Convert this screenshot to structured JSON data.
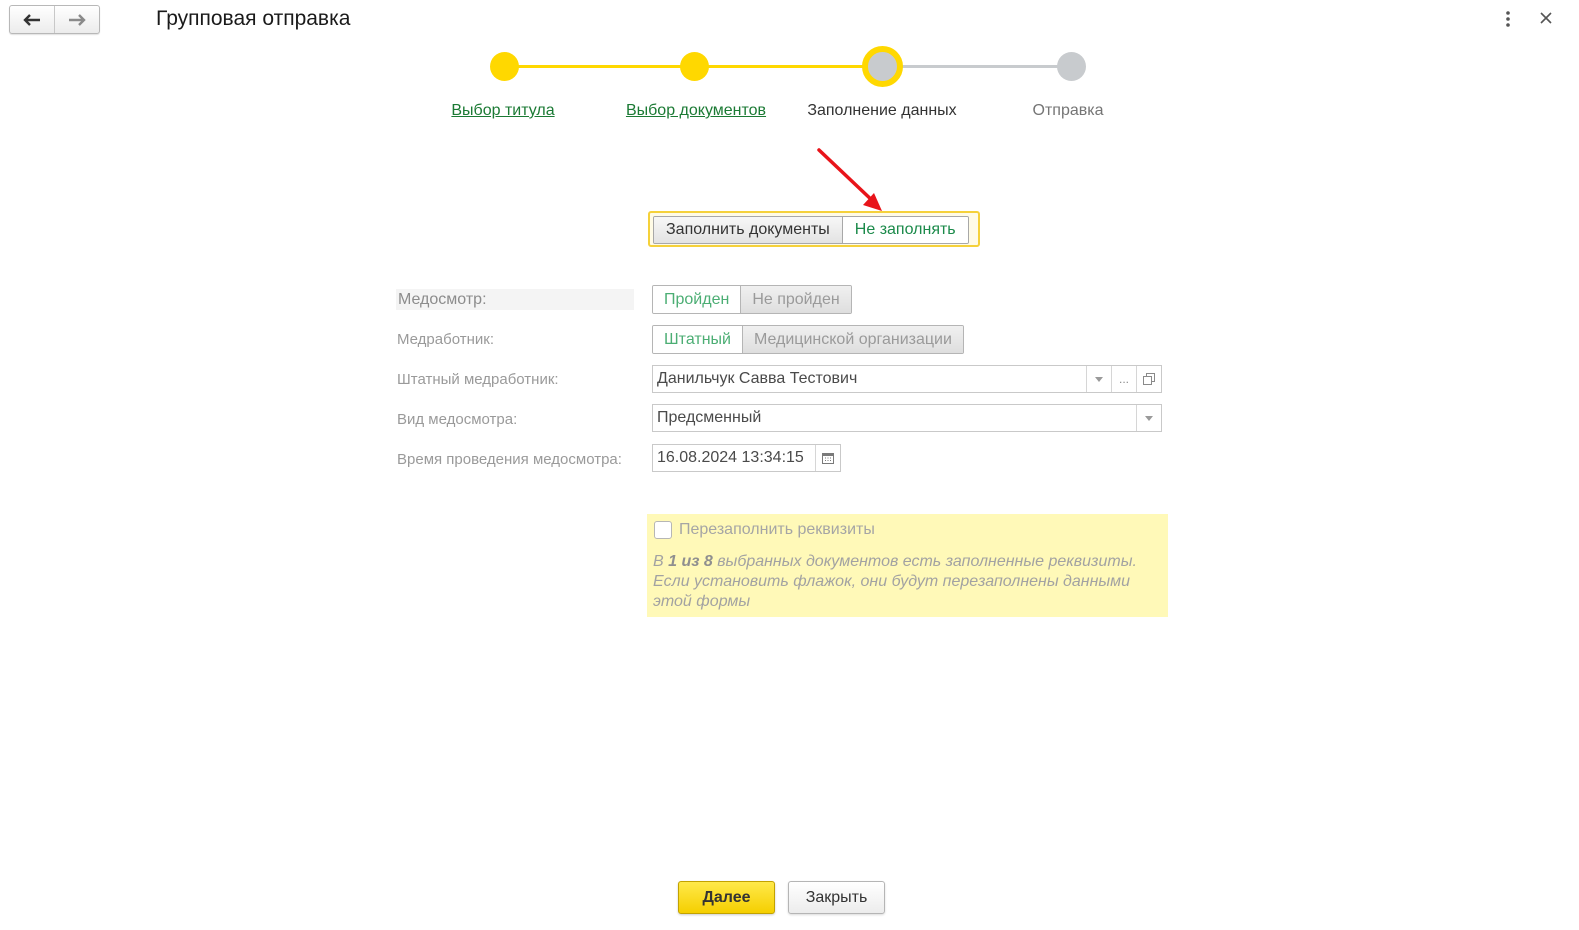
{
  "window": {
    "title": "Групповая отправка",
    "back_icon": "arrow-left-icon",
    "forward_icon": "arrow-right-icon",
    "more_icon": "more-vertical-icon",
    "close_icon": "close-icon"
  },
  "stepper": {
    "steps": [
      {
        "label": "Выбор титула",
        "state": "done"
      },
      {
        "label": "Выбор документов",
        "state": "done"
      },
      {
        "label": "Заполнение данных",
        "state": "current"
      },
      {
        "label": "Отправка",
        "state": "todo"
      }
    ],
    "colors": {
      "done": "#FFD800",
      "todo": "#C8CBCE",
      "link": "#1B7A34"
    }
  },
  "fill_mode": {
    "options": [
      "Заполнить документы",
      "Не заполнять"
    ],
    "selected": "Не заполнять"
  },
  "form": {
    "medosmotr": {
      "label": "Медосмотр:",
      "options": [
        "Пройден",
        "Не пройден"
      ],
      "selected": "Пройден"
    },
    "medworker": {
      "label": "Медработник:",
      "options": [
        "Штатный",
        "Медицинской организации"
      ],
      "selected": "Штатный"
    },
    "staff_medworker": {
      "label": "Штатный медработник:",
      "value": "Данильчук Савва Тестович",
      "ellipsis": "..."
    },
    "exam_type": {
      "label": "Вид медосмотра:",
      "value": "Предсменный"
    },
    "exam_time": {
      "label": "Время проведения медосмотра:",
      "value": "16.08.2024 13:34:15"
    }
  },
  "refill": {
    "checkbox_label": "Перезаполнить реквизиты",
    "checked": false,
    "note_before": "В ",
    "note_bold": "1 из 8",
    "note_after": " выбранных документов есть заполненные реквизиты. Если установить флажок, они будут перезаполнены данными этой формы"
  },
  "footer": {
    "next_label": "Далее",
    "close_label": "Закрыть"
  },
  "accent": {
    "highlight": "#FFF9B8",
    "annotation_arrow": "#E8141A"
  }
}
